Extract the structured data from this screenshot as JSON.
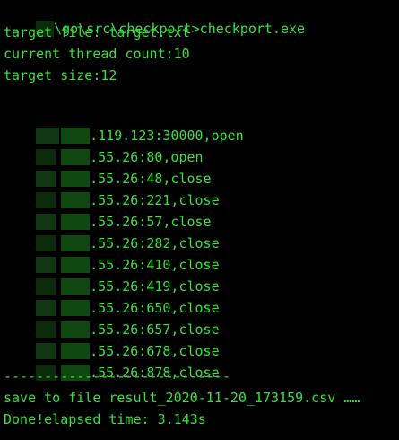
{
  "terminal": {
    "prompt_line": "\\go\\src\\checkport>checkport.exe",
    "info": [
      "target file: target.txt",
      "current thread count:10",
      "target size:12"
    ],
    "results": [
      ".119.123:30000,open",
      ".55.26:80,open",
      ".55.26:48,close",
      ".55.26:221,close",
      ".55.26:57,close",
      ".55.26:282,close",
      ".55.26:410,close",
      ".55.26:419,close",
      ".55.26:650,close",
      ".55.26:657,close",
      ".55.26:678,close",
      ".55.26:878,close"
    ],
    "separator": "----------------------------",
    "save_line": "save to file result_2020-11-20_173159.csv ……",
    "done_line": "Done!elapsed time: 3.143s"
  },
  "colors": {
    "background": "#000000",
    "text": "#35e23a"
  }
}
